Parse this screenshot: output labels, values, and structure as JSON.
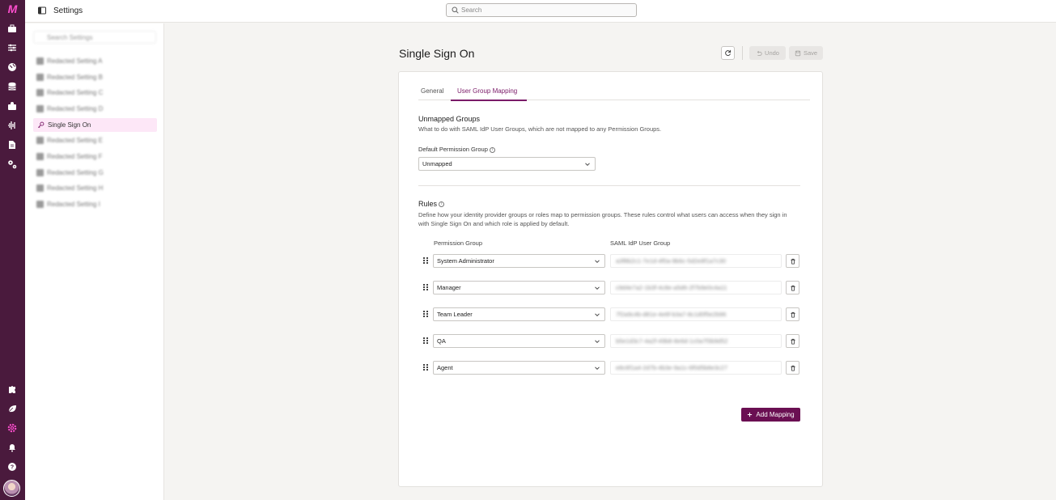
{
  "app": {
    "brand_color": "#4a1a3d",
    "accent_color": "#6a0f52",
    "logo_text": "M",
    "page_title": "Settings"
  },
  "search": {
    "placeholder": "Search"
  },
  "rail_icons": [
    "briefcase-icon",
    "sliders-icon",
    "globe-icon",
    "database-icon",
    "campaign-icon",
    "waveform-icon",
    "document-icon",
    "settings-gears-icon",
    "puzzle-icon",
    "leaf-icon",
    "gear-icon",
    "bell-icon",
    "help-icon"
  ],
  "sidenav": {
    "search_placeholder": "Search Settings",
    "items": [
      {
        "label": "Redacted Setting A",
        "blurred": true
      },
      {
        "label": "Redacted Setting B",
        "blurred": true
      },
      {
        "label": "Redacted Setting C",
        "blurred": true
      },
      {
        "label": "Redacted Setting D",
        "blurred": true
      },
      {
        "label": "Single Sign On",
        "blurred": false,
        "active": true
      },
      {
        "label": "Redacted Setting E",
        "blurred": true
      },
      {
        "label": "Redacted Setting F",
        "blurred": true
      },
      {
        "label": "Redacted Setting G",
        "blurred": true
      },
      {
        "label": "Redacted Setting H",
        "blurred": true
      },
      {
        "label": "Redacted Setting I",
        "blurred": true
      }
    ]
  },
  "main": {
    "title": "Single Sign On",
    "undo_label": "Undo",
    "save_label": "Save",
    "tabs": [
      {
        "label": "General",
        "active": false
      },
      {
        "label": "User Group Mapping",
        "active": true
      }
    ],
    "unmapped": {
      "heading": "Unmapped Groups",
      "description": "What to do with SAML IdP User Groups, which are not mapped to any Permission Groups.",
      "default_label": "Default Permission Group",
      "default_value": "Unmapped"
    },
    "rules": {
      "heading": "Rules",
      "description": "Define how your identity provider groups or roles map to permission groups. These rules control what users can access when they sign in with Single Sign On and which role is applied by default.",
      "col_permission": "Permission Group",
      "col_saml": "SAML IdP User Group",
      "rows": [
        {
          "permission": "System Administrator",
          "saml": "a3f8b2c1-7e1d-4f0a-9b6c-5d2e8f1a7c30"
        },
        {
          "permission": "Manager",
          "saml": "c9d4e7a2-1b3f-4c8e-a5d6-2f7b9e0c4a11"
        },
        {
          "permission": "Team Leader",
          "saml": "7f2a9c4b-d81e-4e6f-b3a7-8c1d0f5e2b96"
        },
        {
          "permission": "QA",
          "saml": "b5e1d3c7-4a2f-49b8-8e6d-1c0a7f3b9d52"
        },
        {
          "permission": "Agent",
          "saml": "e8c6f1a4-2d7b-4b3e-9a1c-6f0d5b8e3c27"
        }
      ],
      "add_label": "Add Mapping"
    }
  }
}
